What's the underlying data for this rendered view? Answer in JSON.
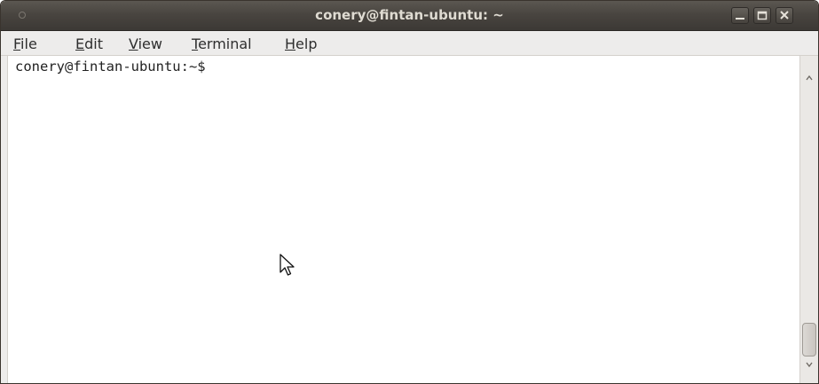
{
  "window": {
    "title": "conery@fintan-ubuntu: ~",
    "buttons": {
      "minimize": "minimize-icon",
      "maximize": "maximize-icon",
      "close": "close-icon"
    }
  },
  "menubar": {
    "items": [
      {
        "label_mnemonic": "F",
        "label_rest": "ile"
      },
      {
        "label_mnemonic": "E",
        "label_rest": "dit"
      },
      {
        "label_mnemonic": "V",
        "label_rest": "iew"
      },
      {
        "label_mnemonic": "T",
        "label_rest": "erminal"
      },
      {
        "label_mnemonic": "H",
        "label_rest": "elp"
      }
    ]
  },
  "terminal": {
    "prompt": "conery@fintan-ubuntu:~$ "
  },
  "colors": {
    "titlebar": "#4a4641",
    "title_text": "#dfdbd2",
    "menubar": "#edeceb",
    "terminal_bg": "#ffffff"
  }
}
